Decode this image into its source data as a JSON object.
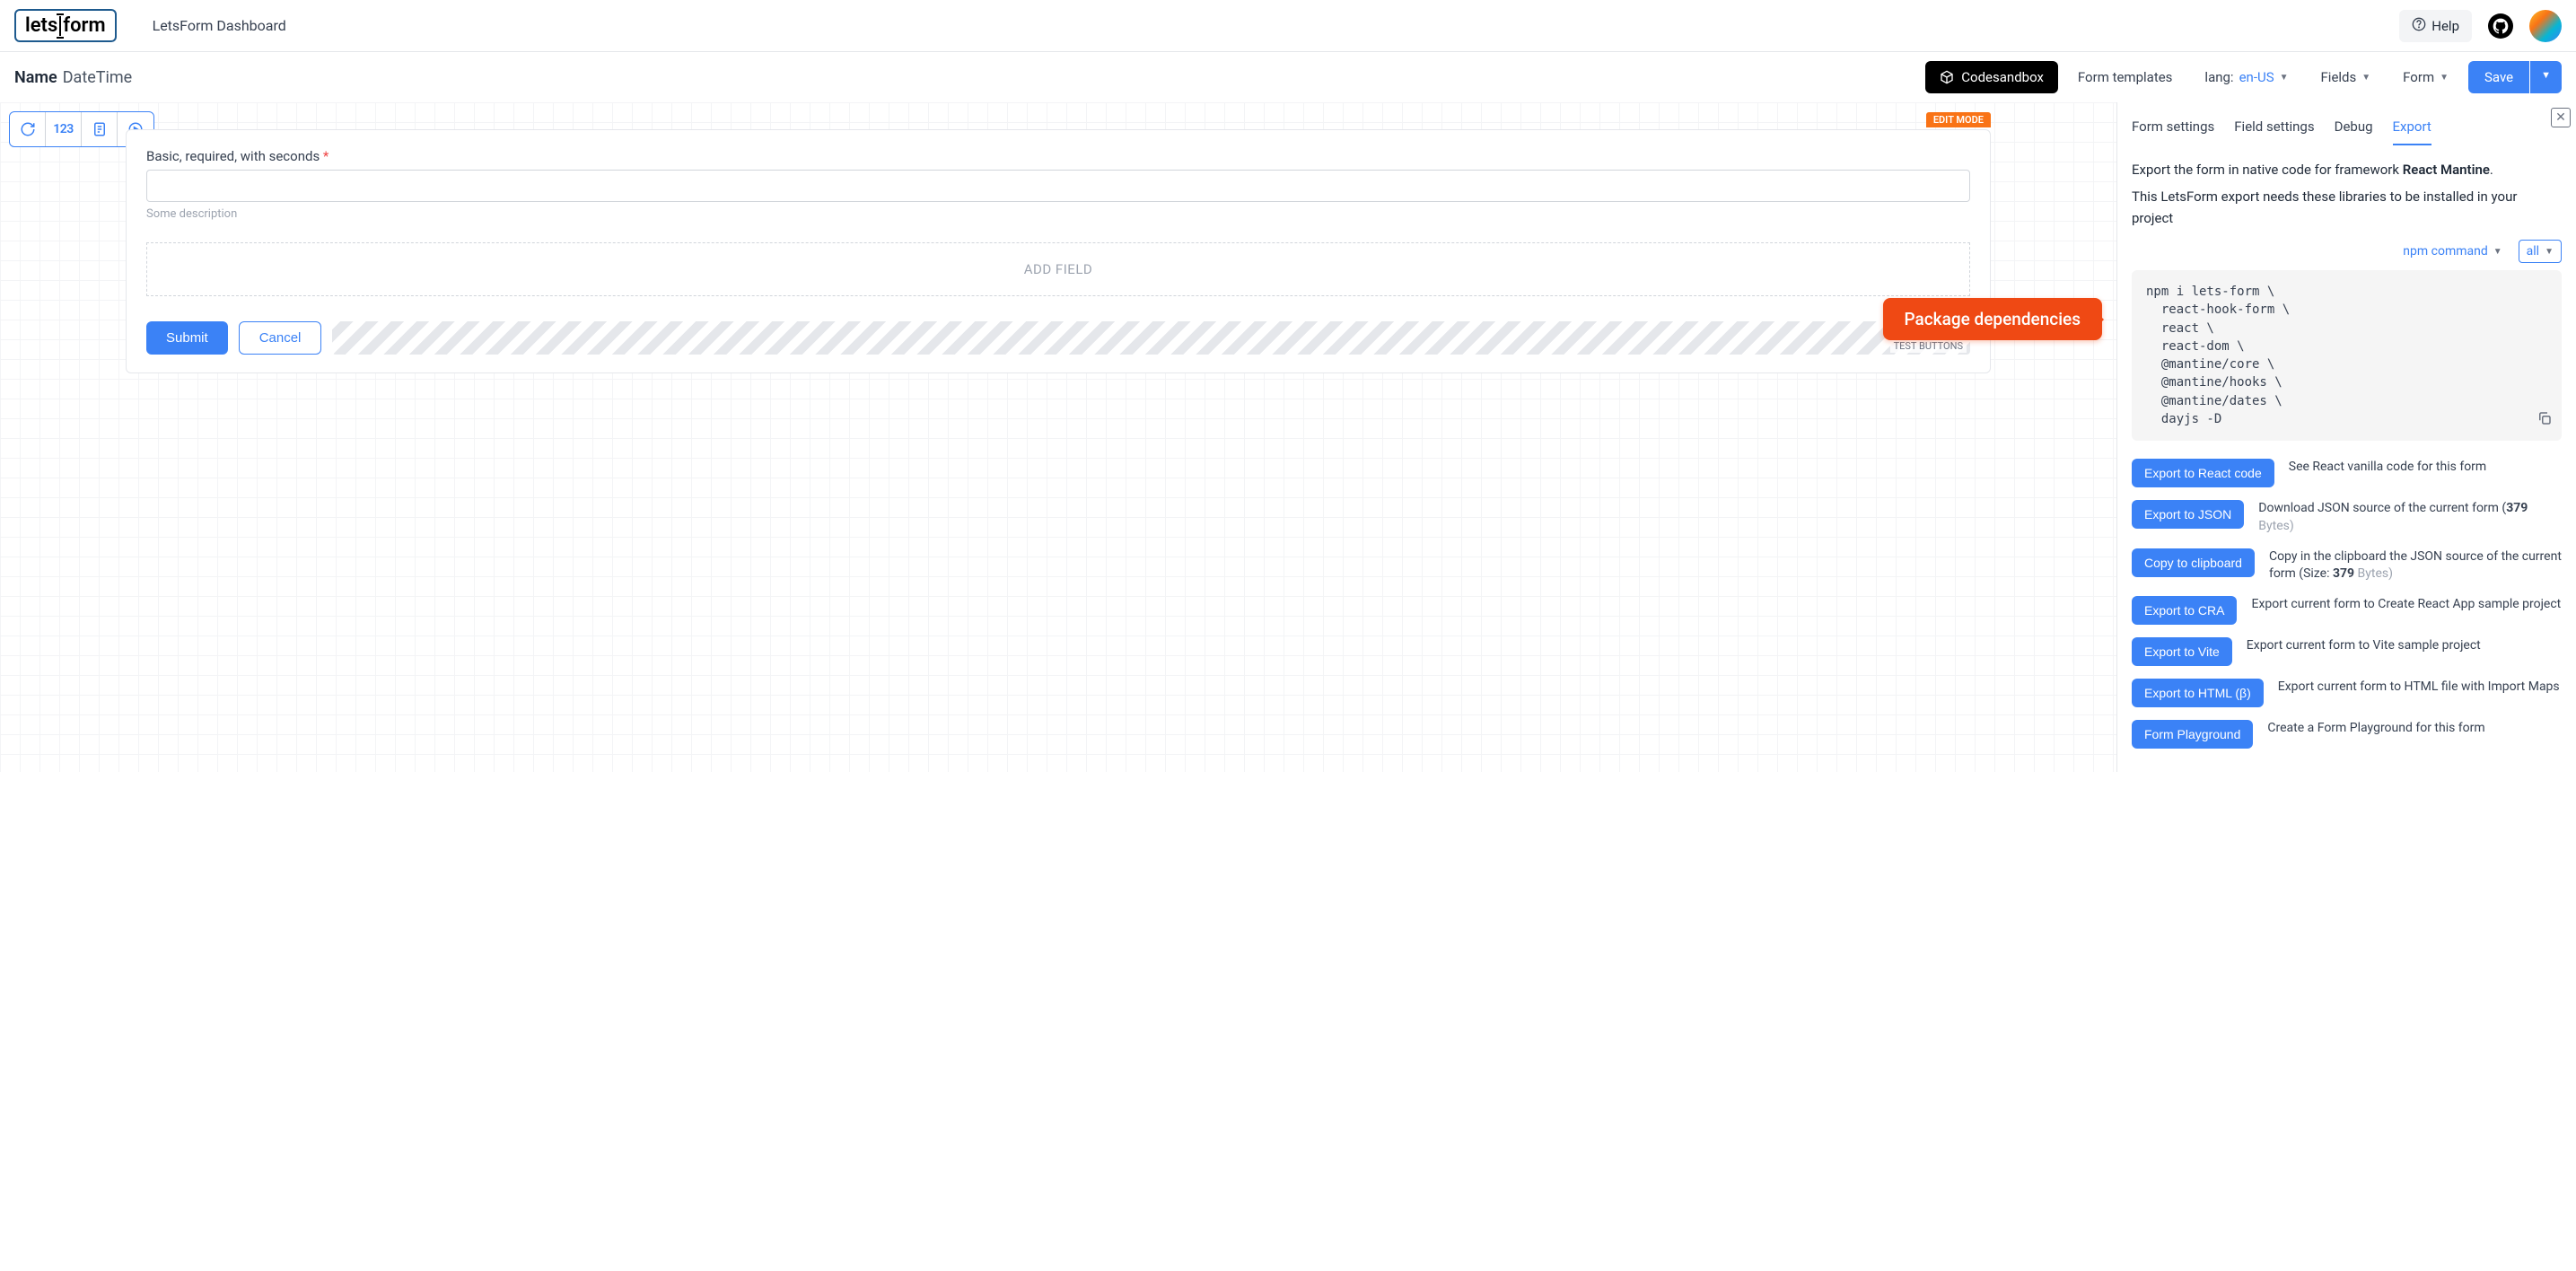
{
  "header": {
    "logo_parts": {
      "lets": "lets",
      "form": "form"
    },
    "dashboard_title": "LetsForm Dashboard",
    "help_label": "Help"
  },
  "toolbar": {
    "name_label": "Name",
    "name_value": "DateTime",
    "codesandbox_label": "Codesandbox",
    "form_templates_label": "Form templates",
    "lang_prefix": "lang:",
    "lang_value": "en-US",
    "fields_label": "Fields",
    "form_label": "Form",
    "save_label": "Save"
  },
  "form": {
    "edit_mode_badge": "EDIT MODE",
    "field_label": "Basic, required, with seconds",
    "field_hint": "Some description",
    "add_field_label": "ADD FIELD",
    "submit_label": "Submit",
    "cancel_label": "Cancel",
    "test_buttons_badge": "TEST BUTTONS"
  },
  "callout": {
    "text": "Package dependencies"
  },
  "panel": {
    "tabs": [
      "Form settings",
      "Field settings",
      "Debug",
      "Export"
    ],
    "active_tab": "Export",
    "export_desc_prefix": "Export the form in native code for framework ",
    "export_desc_framework": "React Mantine",
    "export_desc_suffix": ".",
    "export_libs_note": "This LetsForm export needs these libraries to be installed in your project",
    "selectors": {
      "npm_label": "npm command",
      "all_label": "all"
    },
    "code": "npm i lets-form \\\n  react-hook-form \\\n  react \\\n  react-dom \\\n  @mantine/core \\\n  @mantine/hooks \\\n  @mantine/dates \\\n  dayjs -D",
    "actions": [
      {
        "btn": "Export to React code",
        "desc_pre": "See React vanilla code for this form",
        "size": "",
        "desc_post": ""
      },
      {
        "btn": "Export to JSON",
        "desc_pre": "Download JSON source of the current form (",
        "size": "379",
        "desc_post": " Bytes)"
      },
      {
        "btn": "Copy to clipboard",
        "desc_pre": "Copy in the clipboard the JSON source of the current form (Size: ",
        "size": "379",
        "desc_post": " Bytes)"
      },
      {
        "btn": "Export to CRA",
        "desc_pre": "Export current form to Create React App sample project",
        "size": "",
        "desc_post": ""
      },
      {
        "btn": "Export to Vite",
        "desc_pre": "Export current form to Vite sample project",
        "size": "",
        "desc_post": ""
      },
      {
        "btn": "Export to HTML (β)",
        "desc_pre": "Export current form to HTML file with Import Maps",
        "size": "",
        "desc_post": ""
      },
      {
        "btn": "Form Playground",
        "desc_pre": "Create a Form Playground for this form",
        "size": "",
        "desc_post": ""
      }
    ]
  }
}
